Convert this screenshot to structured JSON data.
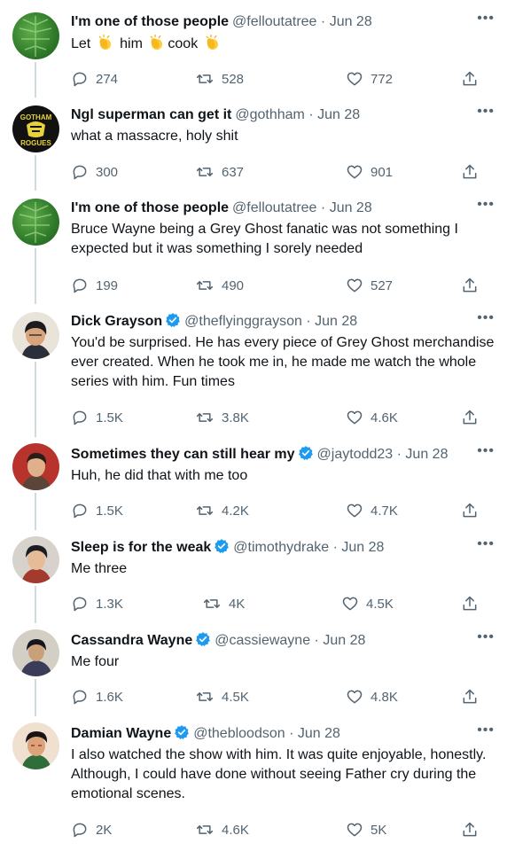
{
  "tweets": [
    {
      "name": "I'm one of those people",
      "handle": "@felloutatree",
      "date": "Jun 28",
      "verified": false,
      "text": "",
      "replies": "274",
      "retweets": "528",
      "likes": "772"
    },
    {
      "name": "Ngl superman can get it",
      "handle": "@gothham",
      "date": "Jun 28",
      "verified": false,
      "text": "what a massacre, holy shit",
      "replies": "300",
      "retweets": "637",
      "likes": "901",
      "avatar_text_top": "GOTHAM",
      "avatar_text_bottom": "ROGUES"
    },
    {
      "name": "I'm one of those people",
      "handle": "@felloutatree",
      "date": "Jun 28",
      "verified": false,
      "text": "Bruce Wayne being a Grey Ghost fanatic was not something I expected but it was something I sorely needed",
      "replies": "199",
      "retweets": "490",
      "likes": "527"
    },
    {
      "name": "Dick Grayson",
      "handle": "@theflyinggrayson",
      "date": "Jun 28",
      "verified": true,
      "text": "You'd be surprised. He has every piece of Grey Ghost merchandise ever created. When he took me in, he made me watch the whole series with him. Fun times",
      "replies": "1.5K",
      "retweets": "3.8K",
      "likes": "4.6K"
    },
    {
      "name": "Sometimes they can still hear my",
      "handle": "@jaytodd23",
      "date": "Jun 28",
      "verified": true,
      "text": "Huh, he did that with me too",
      "replies": "1.5K",
      "retweets": "4.2K",
      "likes": "4.7K"
    },
    {
      "name": "Sleep is for the weak",
      "handle": "@timothydrake",
      "date": "Jun 28",
      "verified": true,
      "text": "Me three",
      "replies": "1.3K",
      "retweets": "4K",
      "likes": "4.5K"
    },
    {
      "name": "Cassandra Wayne",
      "handle": "@cassiewayne",
      "date": "Jun 28",
      "verified": true,
      "text": "Me four",
      "replies": "1.6K",
      "retweets": "4.5K",
      "likes": "4.8K"
    },
    {
      "name": "Damian Wayne",
      "handle": "@thebloodson",
      "date": "Jun 28",
      "verified": true,
      "text": "I also watched the show with him. It was quite enjoyable, honestly. Although, I could have done without seeing Father cry during the emotional scenes.",
      "replies": "2K",
      "retweets": "4.6K",
      "likes": "5K"
    }
  ],
  "first_tweet_words": [
    "Let",
    "him",
    "cook"
  ],
  "separator": "·",
  "more_label": "•••",
  "colors": {
    "text": "#0f1419",
    "muted": "#536471",
    "verified": "#1d9bf0",
    "line": "#cfd9de"
  },
  "icons": [
    "reply-icon",
    "retweet-icon",
    "like-icon",
    "share-icon",
    "verified-badge-icon",
    "clapping-hands-emoji"
  ]
}
